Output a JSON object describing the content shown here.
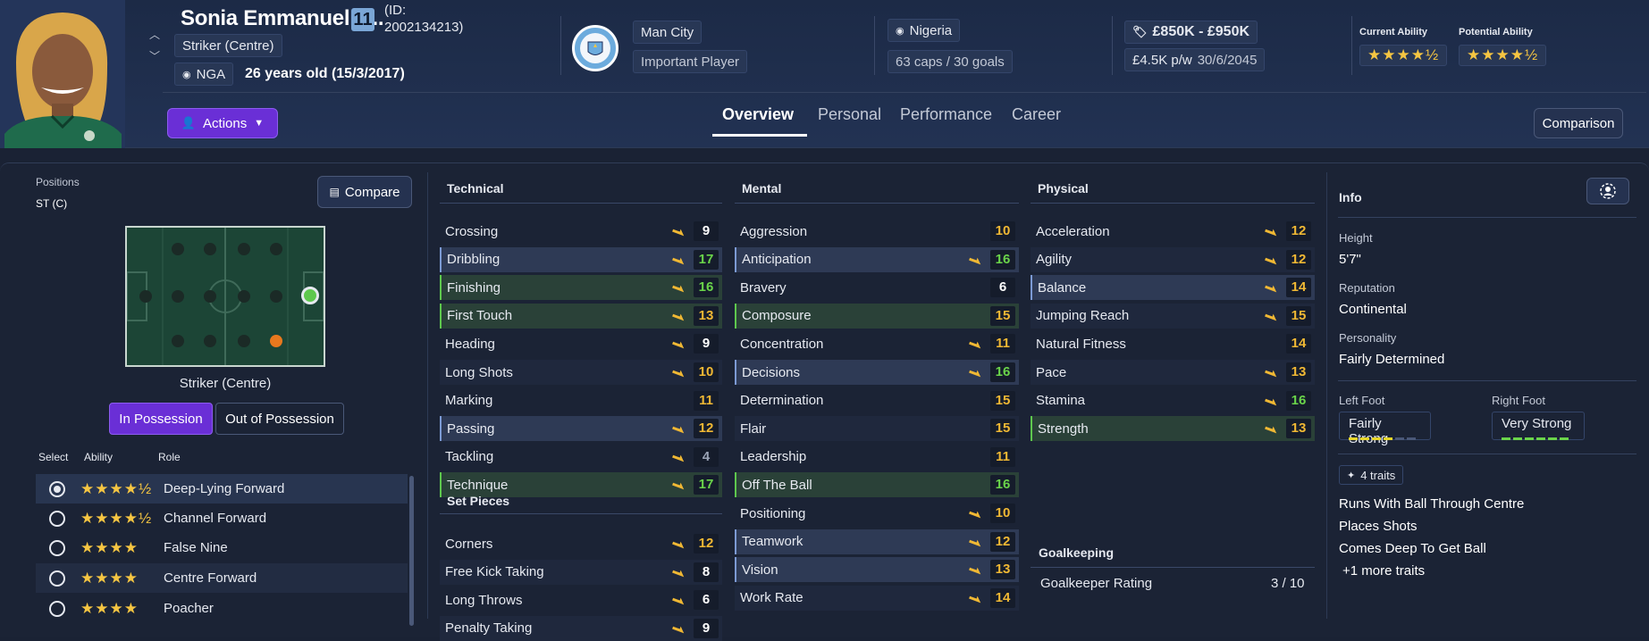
{
  "player": {
    "name": "Sonia Emmanuel P...",
    "number": "11",
    "id_label": "(ID:",
    "id_value": "2002134213)",
    "position": "Striker (Centre)",
    "nation_code": "NGA",
    "age": "26 years old (15/3/2017)"
  },
  "club": {
    "name": "Man City",
    "status": "Important Player",
    "crest_text": "MANCHESTER CITY"
  },
  "nation": {
    "name": "Nigeria",
    "caps": "63 caps / 30 goals"
  },
  "contract": {
    "value": "£850K - £950K",
    "wage": "£4.5K p/w",
    "expiry": "30/6/2045"
  },
  "ability": {
    "current_label": "Current Ability",
    "current_stars": "★★★★½",
    "potential_label": "Potential Ability",
    "potential_stars": "★★★★½"
  },
  "actions_label": "Actions",
  "tabs": [
    "Overview",
    "Personal",
    "Performance",
    "Career"
  ],
  "comparison_label": "Comparison",
  "positions": {
    "heading": "Positions",
    "value": "ST (C)",
    "compare_label": "Compare",
    "pitch_caption": "Striker (Centre)",
    "toggle_in": "In Possession",
    "toggle_out": "Out of Possession",
    "col_select": "Select",
    "col_ability": "Ability",
    "col_role": "Role",
    "roles": [
      {
        "stars": "★★★★½",
        "name": "Deep-Lying Forward"
      },
      {
        "stars": "★★★★½",
        "name": "Channel Forward"
      },
      {
        "stars": "★★★★",
        "name": "False Nine"
      },
      {
        "stars": "★★★★",
        "name": "Centre Forward"
      },
      {
        "stars": "★★★★",
        "name": "Poacher"
      }
    ]
  },
  "technical": {
    "heading": "Technical",
    "rows": [
      {
        "name": "Crossing",
        "value": "9"
      },
      {
        "name": "Dribbling",
        "value": "17"
      },
      {
        "name": "Finishing",
        "value": "16"
      },
      {
        "name": "First Touch",
        "value": "13"
      },
      {
        "name": "Heading",
        "value": "9"
      },
      {
        "name": "Long Shots",
        "value": "10"
      },
      {
        "name": "Marking",
        "value": "11"
      },
      {
        "name": "Passing",
        "value": "12"
      },
      {
        "name": "Tackling",
        "value": "4"
      },
      {
        "name": "Technique",
        "value": "17"
      }
    ]
  },
  "set_pieces": {
    "heading": "Set Pieces",
    "rows": [
      {
        "name": "Corners",
        "value": "12"
      },
      {
        "name": "Free Kick Taking",
        "value": "8"
      },
      {
        "name": "Long Throws",
        "value": "6"
      },
      {
        "name": "Penalty Taking",
        "value": "9"
      }
    ]
  },
  "mental": {
    "heading": "Mental",
    "rows": [
      {
        "name": "Aggression",
        "value": "10"
      },
      {
        "name": "Anticipation",
        "value": "16"
      },
      {
        "name": "Bravery",
        "value": "6"
      },
      {
        "name": "Composure",
        "value": "15"
      },
      {
        "name": "Concentration",
        "value": "11"
      },
      {
        "name": "Decisions",
        "value": "16"
      },
      {
        "name": "Determination",
        "value": "15"
      },
      {
        "name": "Flair",
        "value": "15"
      },
      {
        "name": "Leadership",
        "value": "11"
      },
      {
        "name": "Off The Ball",
        "value": "16"
      },
      {
        "name": "Positioning",
        "value": "10"
      },
      {
        "name": "Teamwork",
        "value": "12"
      },
      {
        "name": "Vision",
        "value": "13"
      },
      {
        "name": "Work Rate",
        "value": "14"
      }
    ]
  },
  "physical": {
    "heading": "Physical",
    "rows": [
      {
        "name": "Acceleration",
        "value": "12"
      },
      {
        "name": "Agility",
        "value": "12"
      },
      {
        "name": "Balance",
        "value": "14"
      },
      {
        "name": "Jumping Reach",
        "value": "15"
      },
      {
        "name": "Natural Fitness",
        "value": "14"
      },
      {
        "name": "Pace",
        "value": "13"
      },
      {
        "name": "Stamina",
        "value": "16"
      },
      {
        "name": "Strength",
        "value": "13"
      }
    ]
  },
  "goalkeeping": {
    "heading": "Goalkeeping",
    "label": "Goalkeeper Rating",
    "value": "3 / 10"
  },
  "info": {
    "heading": "Info",
    "height_label": "Height",
    "height": "5'7\"",
    "reputation_label": "Reputation",
    "reputation": "Continental",
    "personality_label": "Personality",
    "personality": "Fairly Determined",
    "left_foot_label": "Left Foot",
    "left_foot": "Fairly Strong",
    "right_foot_label": "Right Foot",
    "right_foot": "Very Strong",
    "left_foot_level": 0.6,
    "right_foot_level": 1.0,
    "traits_badge": "4 traits",
    "traits": [
      "Runs With Ball Through Centre",
      "Places Shots",
      "Comes Deep To Get Ball"
    ],
    "more_traits": "+1 more traits"
  },
  "colors": {
    "accent": "#6a2fd6",
    "good": "#6ad44a",
    "mid": "#f0b834",
    "high": "#ffffff"
  }
}
